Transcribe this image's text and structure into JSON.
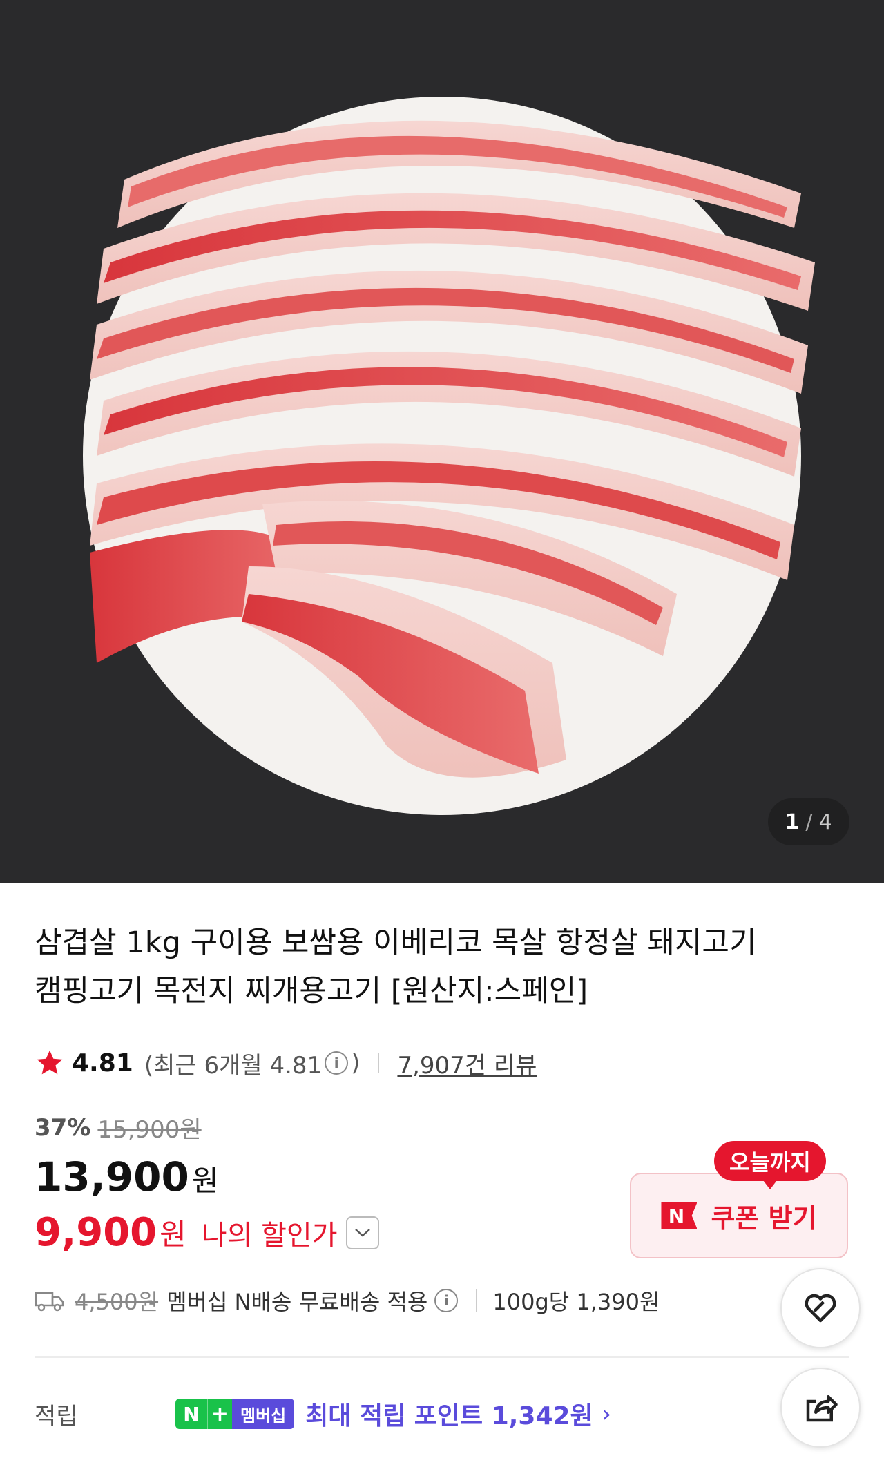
{
  "gallery": {
    "current": "1",
    "separator": "/",
    "total": "4"
  },
  "product": {
    "title_line1": "삼겹살 1kg 구이용 보쌈용 이베리코 목살 항정살 돼지고기",
    "title_line2": "캠핑고기 목전지 찌개용고기 [원산지:스페인]"
  },
  "rating": {
    "score": "4.81",
    "recent_prefix": "(최근 6개월 4.81",
    "recent_suffix": ")",
    "info": "i",
    "review_count": "7,907건 리뷰"
  },
  "price": {
    "discount_pct": "37%",
    "original": "15,900원",
    "sale": "13,900",
    "sale_unit": "원",
    "my_price": "9,900",
    "my_price_unit": "원",
    "my_label": "나의 할인가"
  },
  "coupon": {
    "badge": "N",
    "tag": "오늘까지",
    "label": "쿠폰 받기"
  },
  "shipping": {
    "fee": "4,500원",
    "text": "멤버십 N배송 무료배송 적용",
    "info": "i",
    "unit_price": "100g당 1,390원"
  },
  "points": {
    "label": "적립",
    "badge_n": "N",
    "badge_plus": "+",
    "badge_member": "멤버십",
    "text": "최대 적립 포인트 1,342원",
    "arrow": "›"
  },
  "colors": {
    "accent_red": "#e5162e",
    "member_purple": "#5a4bdb",
    "naver_green": "#19c24a"
  },
  "icons": [
    "star-icon",
    "info-icon",
    "chevron-down-icon",
    "truck-icon",
    "heart-icon",
    "share-icon"
  ]
}
